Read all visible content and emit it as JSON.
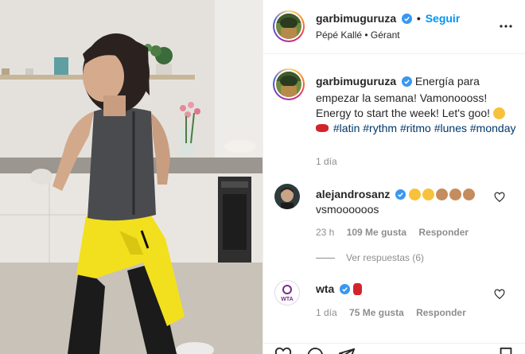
{
  "post": {
    "author": "garbimuguruza",
    "follow_label": "Seguir",
    "separator": "•",
    "audio": "Pépé Kallé • Gérant",
    "caption": {
      "text_line": "Energía para empezar la semana! Vamonoooss! Energy to start the week! Let's goo!",
      "hashtags": [
        "#latin",
        "#rythm",
        "#ritmo",
        "#lunes",
        "#monday"
      ]
    },
    "time": "1 día"
  },
  "comments": [
    {
      "user": "alejandrosanz",
      "text": "vsmoooooos",
      "time": "23 h",
      "likes": "109 Me gusta",
      "reply_label": "Responder",
      "view_replies": "Ver respuestas (6)"
    },
    {
      "user": "wta",
      "avatar_text": "WTA",
      "time": "1 día",
      "likes": "75 Me gusta",
      "reply_label": "Responder"
    }
  ],
  "colors": {
    "accent": "#0095f6",
    "hashtag": "#00376b",
    "muted": "#8e8e8e",
    "verified": "#3897f0",
    "shirt": "#f2e01e"
  },
  "icons": [
    "verified-icon",
    "more-icon",
    "heart-icon",
    "comment-icon",
    "share-icon",
    "bookmark-icon"
  ]
}
